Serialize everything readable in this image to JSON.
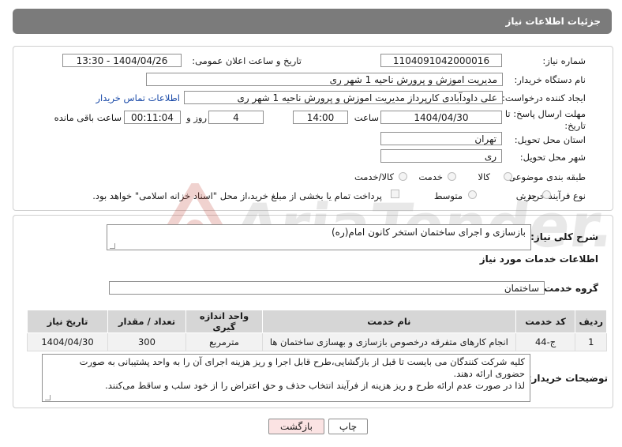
{
  "header": {
    "title": "جزئیات اطلاعات نیاز"
  },
  "info": {
    "need_number_label": "شماره نیاز:",
    "need_number": "1104091042000016",
    "announce_label": "تاریخ و ساعت اعلان عمومی:",
    "announce_value": "1404/04/26 - 13:30",
    "buyer_org_label": "نام دستگاه خریدار:",
    "buyer_org": "مدیریت اموزش و پرورش ناحیه 1 شهر ری",
    "requester_label": "ایجاد کننده درخواست:",
    "requester": "علی داودآبادی کارپرداز مدیریت اموزش و پرورش ناحیه 1 شهر ری",
    "buyer_contact_link": "اطلاعات تماس خریدار",
    "deadline_label_1": "مهلت ارسال پاسخ: تا",
    "deadline_label_2": "تاریخ:",
    "deadline_date": "1404/04/30",
    "time_label": "ساعت",
    "deadline_time": "14:00",
    "days_value": "4",
    "days_label": "روز و",
    "remaining_time": "00:11:04",
    "remaining_label": "ساعت باقی مانده",
    "province_label": "استان محل تحویل:",
    "province": "تهران",
    "city_label": "شهر محل تحویل:",
    "city": "ری",
    "category_label": "طبقه بندی موضوعی:",
    "category_options": [
      "کالا",
      "خدمت",
      "کالا/خدمت"
    ],
    "process_label": "نوع فرآیند خرید :",
    "process_options": [
      "جزیی",
      "متوسط"
    ],
    "payment_note": "پرداخت تمام یا بخشی از مبلغ خرید،از محل \"اسناد خزانه اسلامی\" خواهد بود."
  },
  "details": {
    "summary_label": "شرح کلی نیاز:",
    "summary": "بازسازی و اجرای ساختمان استخر کانون امام(ره)",
    "services_title": "اطلاعات خدمات مورد نیاز",
    "group_label": "گروه خدمت:",
    "group_value": "ساختمان",
    "table": {
      "headers": [
        "ردیف",
        "کد خدمت",
        "نام خدمت",
        "واحد اندازه گیری",
        "تعداد / مقدار",
        "تاریخ نیاز"
      ],
      "rows": [
        [
          "1",
          "ج-44",
          "انجام کارهای متفرقه درخصوص بازسازی و بهسازی ساختمان ها",
          "مترمربع",
          "300",
          "1404/04/30"
        ]
      ]
    },
    "notes_label": "توضیحات خریدار:",
    "notes_line1": "کلیه شرکت کنندگان می بایست تا قبل از بازگشایی،طرح قابل اجرا و ریز هزینه اجرای آن را به واحد پشتیبانی به صورت",
    "notes_line2": "حضوری ارائه دهند.",
    "notes_line3": "لذا در صورت عدم ارائه طرح و ریز هزینه از فرآیند انتخاب حذف و حق اعتراض را از خود سلب و ساقط می‌کنند."
  },
  "buttons": {
    "print": "چاپ",
    "back": "بازگشت"
  },
  "colors": {
    "header_bg": "#7b7b7b",
    "link": "#1a4aa8",
    "back_btn_bg": "#fbe3e3",
    "watermark": "#c0392b"
  }
}
